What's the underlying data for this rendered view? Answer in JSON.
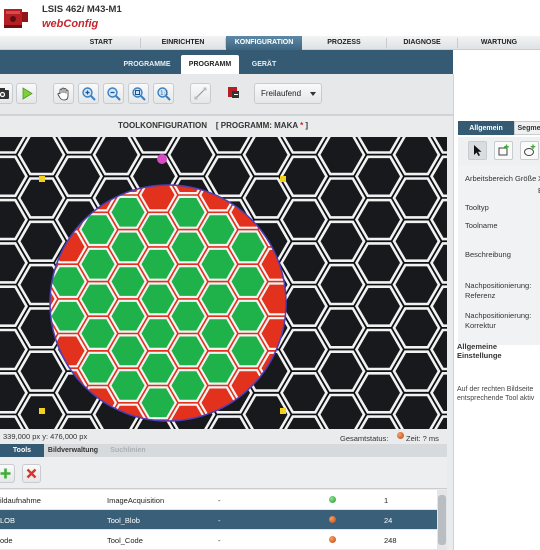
{
  "header": {
    "title_main": "LSIS 462",
    "title_italic": "i",
    "title_suffix": " M43-M1",
    "subtitle": "webConfig"
  },
  "nav": {
    "items": [
      {
        "label": "START"
      },
      {
        "label": "EINRICHTEN"
      },
      {
        "label": "KONFIGURATION",
        "active": true
      },
      {
        "label": "PROZESS"
      },
      {
        "label": "DIAGNOSE"
      },
      {
        "label": "WARTUNG"
      }
    ]
  },
  "subnav": {
    "items": [
      {
        "label": "PROGRAMME"
      },
      {
        "label": "PROGRAMM",
        "active": true
      },
      {
        "label": "GERÄT"
      }
    ]
  },
  "toolbar": {
    "buttons": [
      "camera-icon",
      "play-icon",
      "hand-icon",
      "zoom-in-icon",
      "zoom-out-icon",
      "zoom-fit-icon",
      "zoom-actual-icon",
      "crosshair-icon",
      "device-icon"
    ],
    "mode_value": "Freilaufend"
  },
  "config": {
    "title": "TOOLKONFIGURATION    [ PROGRAMM: MAKA ",
    "star": "*",
    "title_end": " ]"
  },
  "status": {
    "coords": "339,000 px y: 476,000 px",
    "label": "Gesamtstatus:",
    "time": "Zeit: ? ms",
    "status_color": "#d4551a"
  },
  "tabs": {
    "items": [
      {
        "label": "Tools",
        "active": true
      },
      {
        "label": "Bildverwaltung"
      },
      {
        "label": "Suchlinien",
        "disabled": true
      }
    ]
  },
  "tool_table": {
    "rows": [
      {
        "name": "ildaufnahme",
        "type": "ImageAcquisition",
        "dash": "-",
        "status": "green",
        "value": "1"
      },
      {
        "name": "LOB",
        "type": "Tool_Blob",
        "dash": "-",
        "status": "orange",
        "value": "24",
        "selected": true
      },
      {
        "name": "ode",
        "type": "Tool_Code",
        "dash": "-",
        "status": "orange",
        "value": "248"
      }
    ]
  },
  "right_panel": {
    "tabs": [
      {
        "label": "Allgemein",
        "active": true
      },
      {
        "label": "Segme"
      }
    ],
    "fields": [
      {
        "label": "Arbeitsbereich Größe",
        "value": "X"
      },
      {
        "label": "Tooltyp",
        "value": ""
      },
      {
        "label": "Toolname",
        "value": ""
      },
      {
        "label": "Beschreibung",
        "value": ""
      },
      {
        "label": "Nachpositionierung: Referenz",
        "value": ""
      },
      {
        "label": "Nachpositionierung: Korrektur",
        "value": ""
      }
    ],
    "extra_value": "B",
    "section_title": "Allgemeine Einstellunge",
    "desc": "Auf der rechten Bildseite entsprechende Tool aktiv"
  },
  "colors": {
    "accent": "#355a74",
    "brand_red": "#c2272d",
    "blob_green": "#1fb24a",
    "blob_red": "#e2311c",
    "marker_yellow": "#f4d21b",
    "marker_magenta": "#d74bc4"
  }
}
